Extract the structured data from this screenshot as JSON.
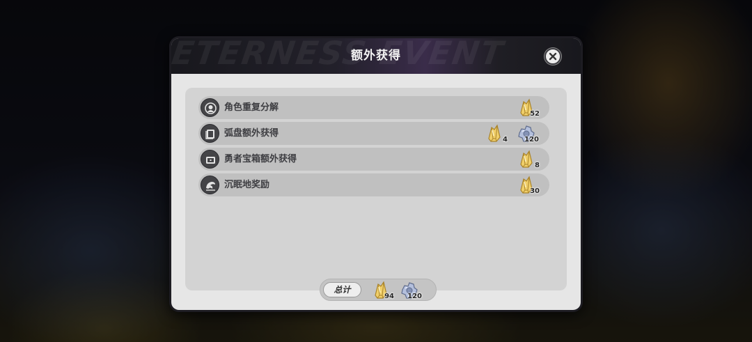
{
  "dialog": {
    "title": "额外获得",
    "title_watermark": "ETERNESS EVENT",
    "close_icon": "close-icon"
  },
  "colors": {
    "gold_item": "#e8c25a",
    "silver_item": "#a7b4d3",
    "row_bg": "#c0c0c0",
    "panel_bg": "#d3d3d3"
  },
  "rows": [
    {
      "label": "角色重复分解",
      "icon": "character-duplicate-icon",
      "rewards": [
        {
          "type": "gold-crystal",
          "count": "52"
        }
      ]
    },
    {
      "label": "弧盘额外获得",
      "icon": "arc-disc-icon",
      "rewards": [
        {
          "type": "gold-crystal",
          "count": "4"
        },
        {
          "type": "silver-gear",
          "count": "120"
        }
      ]
    },
    {
      "label": "勇者宝箱额外获得",
      "icon": "treasure-chest-icon",
      "rewards": [
        {
          "type": "gold-crystal",
          "count": "8"
        }
      ]
    },
    {
      "label": "沉眠地奖励",
      "icon": "dormant-land-icon",
      "rewards": [
        {
          "type": "gold-crystal",
          "count": "30"
        }
      ]
    }
  ],
  "total": {
    "label": "总计",
    "rewards": [
      {
        "type": "gold-crystal",
        "count": "94"
      },
      {
        "type": "silver-gear",
        "count": "120"
      }
    ]
  }
}
